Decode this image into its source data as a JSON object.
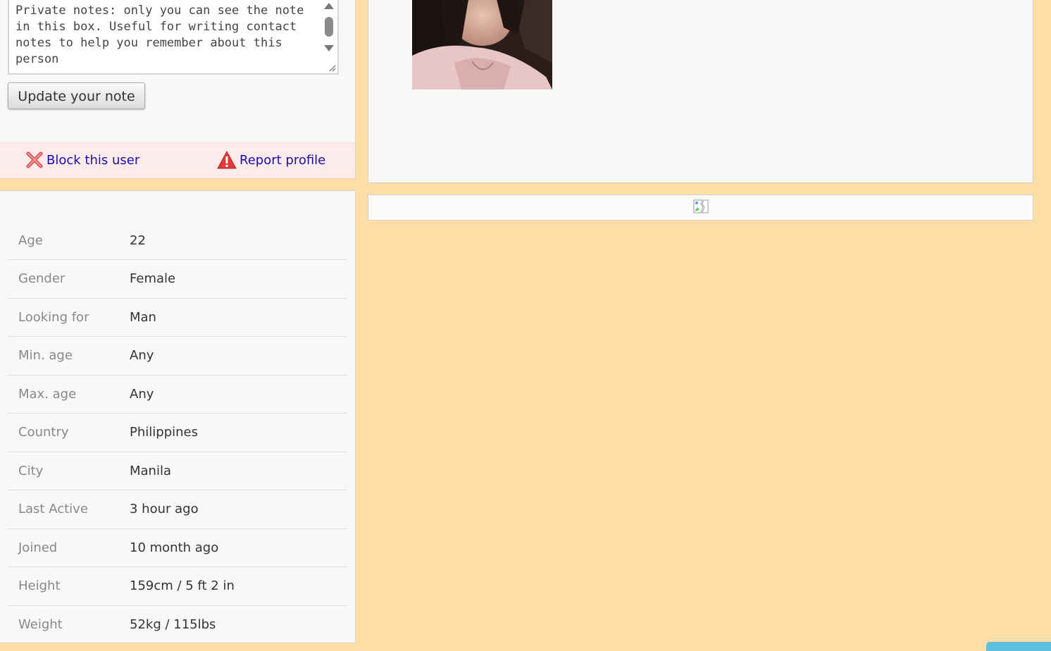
{
  "notes": {
    "text": "Private notes: only you can see the note in this box. Useful for writing contact notes to help you remember about this person",
    "update_label": "Update your note"
  },
  "actions": {
    "block_label": "Block this user",
    "report_label": "Report profile",
    "block_icon": "red-x-icon",
    "report_icon": "warning-triangle-icon"
  },
  "details": [
    {
      "label": "Age",
      "value": "22"
    },
    {
      "label": "Gender",
      "value": "Female"
    },
    {
      "label": "Looking for",
      "value": "Man"
    },
    {
      "label": "Min. age",
      "value": "Any"
    },
    {
      "label": "Max. age",
      "value": "Any"
    },
    {
      "label": "Country",
      "value": "Philippines"
    },
    {
      "label": "City",
      "value": "Manila"
    },
    {
      "label": "Last Active",
      "value": "3 hour ago"
    },
    {
      "label": "Joined",
      "value": "10 month ago"
    },
    {
      "label": "Height",
      "value": "159cm / 5 ft 2 in"
    },
    {
      "label": "Weight",
      "value": "52kg / 115lbs"
    }
  ],
  "colors": {
    "page_bg": "#fddea6",
    "panel_bg": "#f8f8f8",
    "action_bar_bg": "#fdeaea",
    "link": "#1a0dab",
    "corner_tab": "#5bc0de"
  }
}
